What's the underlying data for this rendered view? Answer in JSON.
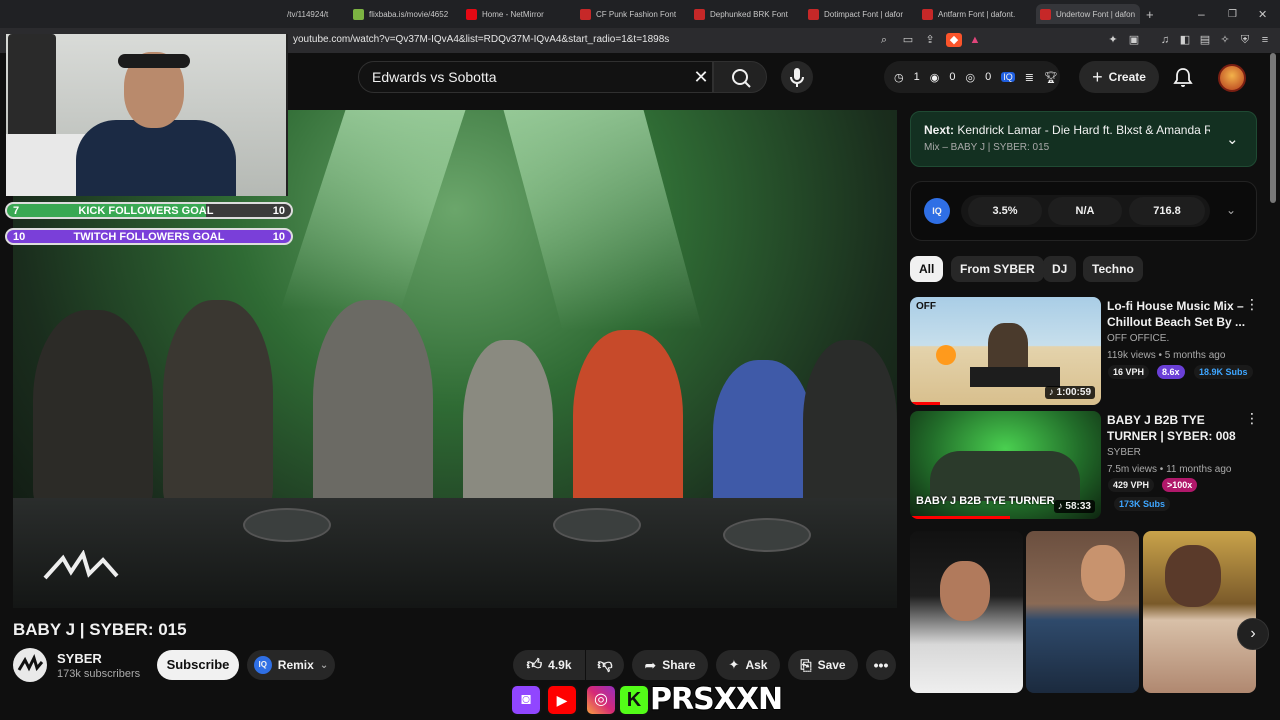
{
  "browser": {
    "tabs": [
      {
        "label": "/tv/114924/t",
        "color": "#5f6368"
      },
      {
        "label": "flixbaba.is/movie/4652",
        "color": "#7cb342"
      },
      {
        "label": "Home - NetMirror",
        "color": "#e50914"
      },
      {
        "label": "CF Punk Fashion Font",
        "color": "#d32f2f"
      },
      {
        "label": "Dephunked BRK Font",
        "color": "#d32f2f"
      },
      {
        "label": "Dotimpact Font | dafor",
        "color": "#d32f2f"
      },
      {
        "label": "Antfarm Font | dafont.",
        "color": "#d32f2f"
      },
      {
        "label": "Undertow Font | dafon",
        "color": "#d32f2f"
      }
    ],
    "new_tab": "+",
    "url": "youtube.com/watch?v=Qv37M-IQvA4&list=RDQv37M-IQvA4&start_radio=1&t=1898s"
  },
  "header": {
    "search_value": "Edwards vs Sobotta",
    "stats": {
      "a": "1",
      "b": "0",
      "c": "0"
    },
    "create_label": "Create"
  },
  "stream_overlay": {
    "kick_goal": {
      "left": "7",
      "label": "KICK FOLLOWERS GOAL",
      "right": "10"
    },
    "twitch_goal": {
      "left": "10",
      "label": "TWITCH FOLLOWERS GOAL",
      "right": "10"
    },
    "handle": "PRSXXN",
    "social_icons": [
      "twitch-icon",
      "youtube-icon",
      "instagram-icon",
      "kick-icon"
    ]
  },
  "video": {
    "title": "BABY J | SYBER: 015",
    "channel": "SYBER",
    "subscribers": "173k subscribers",
    "subscribe_label": "Subscribe",
    "remix_label": "Remix",
    "likes": "4.9k",
    "share_label": "Share",
    "ask_label": "Ask",
    "save_label": "Save"
  },
  "up_next": {
    "prefix": "Next:",
    "title": "Kendrick Lamar - Die Hard ft. Blxst & Amanda R...",
    "subtitle": "Mix – BABY J | SYBER: 015"
  },
  "iq": {
    "v1": "3.5%",
    "v2": "N/A",
    "v3": "716.8",
    "logo": "IQ"
  },
  "chips": [
    "All",
    "From SYBER",
    "DJ",
    "Techno"
  ],
  "recommendations": [
    {
      "title": "Lo-fi House Music Mix – Chillout Beach Set By ...",
      "channel": "OFF OFFICE.",
      "meta": "119k views • 5 months ago",
      "vph": "16 VPH",
      "mult": "8.6x",
      "subs": "18.9K Subs",
      "duration": "1:00:59",
      "thumb_label": "OFF"
    },
    {
      "title": "BABY J B2B TYE TURNER | SYBER: 008",
      "channel": "SYBER",
      "meta": "7.5m views • 11 months ago",
      "vph": "429 VPH",
      "mult": ">100x",
      "subs": "173K Subs",
      "duration": "58:33",
      "thumb_label": "BABY J B2B TYE TURNER"
    }
  ],
  "colors": {
    "accent_purple": "#6a3fd6",
    "accent_green": "#2e9e57",
    "mult_pink": "#b0186a",
    "subs_blue": "#3ea6ff"
  }
}
